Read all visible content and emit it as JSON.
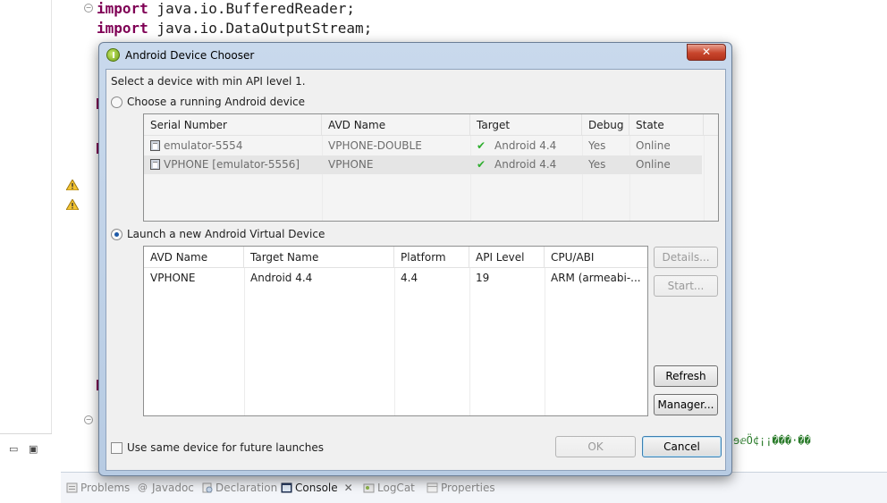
{
  "editor": {
    "code_lines": [
      {
        "keyword": "import",
        "rest": " java.io.BufferedReader;"
      },
      {
        "keyword": "import",
        "rest": " java.io.DataOutputStream;"
      }
    ],
    "garbled_text": "ɘⅇÖ¢¡¡���·��"
  },
  "dialog": {
    "title": "Android Device Chooser",
    "close_label": "✕",
    "prompt": "Select a device with min API level 1.",
    "running_option": {
      "label": "Choose a running Android device",
      "selected": false,
      "columns": [
        "Serial Number",
        "AVD Name",
        "Target",
        "Debug",
        "State"
      ],
      "rows": [
        {
          "serial": "emulator-5554",
          "avd": "VPHONE-DOUBLE",
          "target": "Android 4.4",
          "debug": "Yes",
          "state": "Online"
        },
        {
          "serial": "VPHONE [emulator-5556]",
          "avd": "VPHONE",
          "target": "Android 4.4",
          "debug": "Yes",
          "state": "Online"
        }
      ]
    },
    "launch_option": {
      "label": "Launch a new Android Virtual Device",
      "selected": true,
      "columns": [
        "AVD Name",
        "Target Name",
        "Platform",
        "API Level",
        "CPU/ABI"
      ],
      "rows": [
        {
          "avd": "VPHONE",
          "target": "Android 4.4",
          "platform": "4.4",
          "api": "19",
          "cpu": "ARM (armeabi-..."
        }
      ]
    },
    "buttons": {
      "details": "Details...",
      "start": "Start...",
      "refresh": "Refresh",
      "manager": "Manager...",
      "ok": "OK",
      "cancel": "Cancel"
    },
    "same_device_label": "Use same device for future launches",
    "same_device_checked": false
  },
  "bottom_tabs": [
    {
      "label": "Problems",
      "icon": "problems-icon"
    },
    {
      "label": "Javadoc",
      "icon": "at-icon"
    },
    {
      "label": "Declaration",
      "icon": "declaration-icon"
    },
    {
      "label": "Console",
      "icon": "console-icon",
      "active": true
    },
    {
      "label": "LogCat",
      "icon": "logcat-icon"
    },
    {
      "label": "Properties",
      "icon": "properties-icon"
    }
  ],
  "colors": {
    "keyword": "#7f0055",
    "check": "#2fae2f",
    "close_button": "#c8452c"
  }
}
